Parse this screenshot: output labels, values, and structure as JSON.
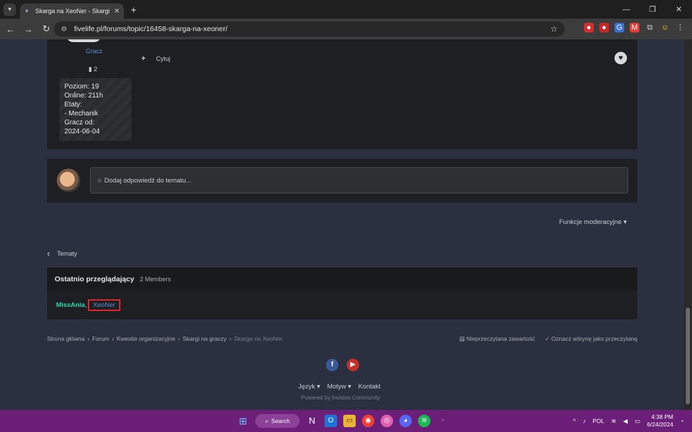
{
  "browser": {
    "tab_title": "Skarga na XeoNer - Skargi na g",
    "url": "fivelife.pl/forums/topic/16458-skarga-na-xeoner/"
  },
  "post": {
    "author_role": "Gracz",
    "posts_count": "2",
    "info_lines": [
      "Poziom: 19",
      "Online: 211h",
      "Etaty:",
      "- Mechanik",
      "Gracz od:",
      "2024-06-04"
    ],
    "quote_label": "Cytuj"
  },
  "reply": {
    "placeholder": "Dodaj odpowiedź do tematu..."
  },
  "moderation": {
    "label": "Funkcje moderacyjne"
  },
  "back": {
    "label": "Tematy"
  },
  "viewers": {
    "title": "Ostatnio przeglądający",
    "count": "2 Members",
    "member_1": "MissAnia",
    "separator": ",",
    "member_2": "XeoNer"
  },
  "breadcrumb": {
    "items": [
      "Strona główna",
      "Forum",
      "Kwestie organizacyjne",
      "Skargi na graczy"
    ],
    "current": "Skarga na XeoNer",
    "unread": "Nieprzeczytana zawartość",
    "mark_read": "Oznacz witrynę jako przeczytaną"
  },
  "footer": {
    "language": "Język",
    "theme": "Motyw",
    "contact": "Kontakt",
    "powered": "Powered by Invision Community"
  },
  "taskbar": {
    "search": "Search",
    "lang": "POL",
    "time": "4:38 PM",
    "date": "6/24/2024"
  }
}
